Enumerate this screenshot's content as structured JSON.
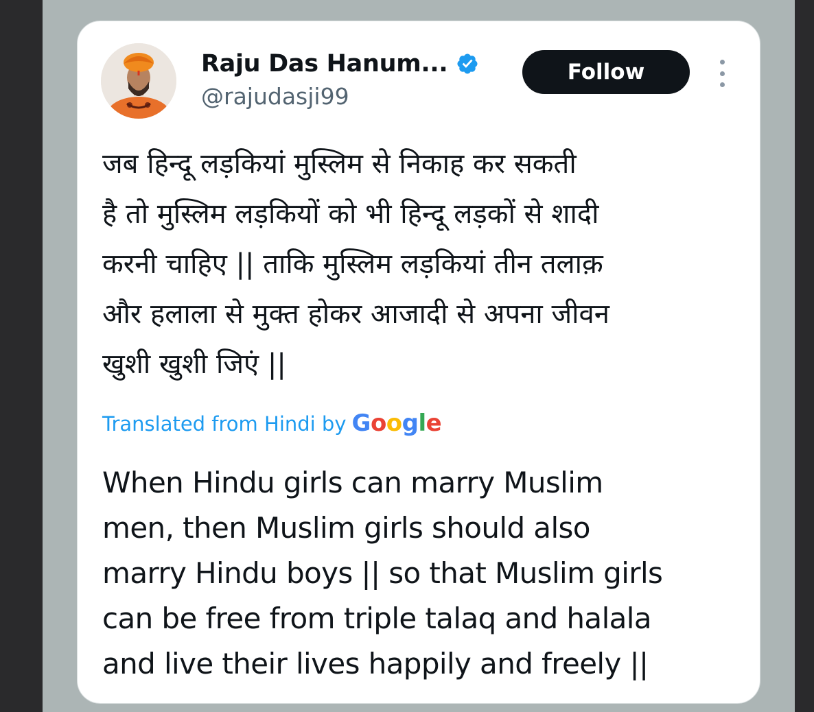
{
  "tweet": {
    "author": {
      "display_name": "Raju Das Hanum...",
      "handle": "@rajudasji99",
      "avatar_icon": "profile-photo-saffron-turban",
      "verified_icon": "verified-badge-icon",
      "verified_color": "#1d9bf0"
    },
    "follow_label": "Follow",
    "more_icon": "more-options-icon",
    "text_hindi": "जब हिन्दू लड़कियां मुस्लिम से निकाह कर सकती\nहै तो मुस्लिम लड़कियों को भी हिन्दू लड़कों से शादी\nकरनी चाहिए || ताकि मुस्लिम लड़कियां तीन तलाक़\nऔर हलाला से मुक्त होकर आजादी से अपना जीवन\nखुशी खुशी जिएं ||",
    "translation": {
      "label": "Translated from Hindi by",
      "provider": "Google",
      "text": "When Hindu girls can marry Muslim\nmen, then Muslim girls should also\nmarry Hindu boys || so that Muslim girls\ncan be free from triple talaq and halala\nand live their lives happily and freely ||"
    }
  },
  "colors": {
    "link_blue": "#1d9bf0",
    "text_primary": "#0f1419",
    "text_secondary": "#536471",
    "follow_bg": "#0f1419",
    "backdrop": "#acb5b5"
  }
}
